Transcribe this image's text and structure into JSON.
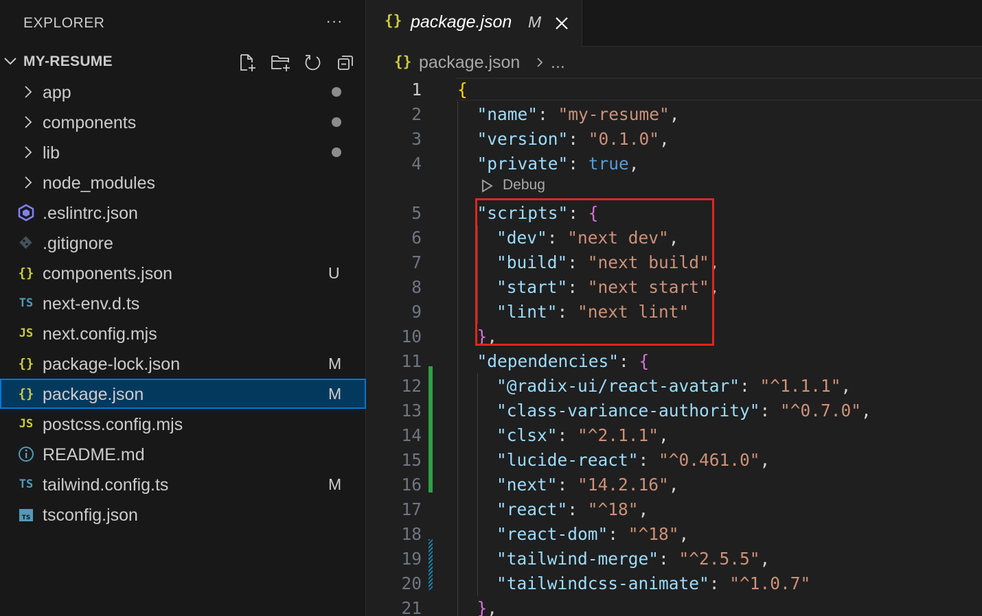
{
  "explorer": {
    "title": "EXPLORER",
    "more_label": "···",
    "project": "MY-RESUME",
    "actions": [
      "new-file-icon",
      "new-folder-icon",
      "refresh-icon",
      "collapse-all-icon"
    ]
  },
  "tree": [
    {
      "label": "app",
      "kind": "folder",
      "decoration": "dot"
    },
    {
      "label": "components",
      "kind": "folder",
      "decoration": "dot"
    },
    {
      "label": "lib",
      "kind": "folder",
      "decoration": "dot"
    },
    {
      "label": "node_modules",
      "kind": "folder",
      "decoration": ""
    },
    {
      "label": ".eslintrc.json",
      "kind": "eslint",
      "decoration": ""
    },
    {
      "label": ".gitignore",
      "kind": "git",
      "decoration": ""
    },
    {
      "label": "components.json",
      "kind": "json",
      "icon": "{}",
      "decoration": "U"
    },
    {
      "label": "next-env.d.ts",
      "kind": "ts",
      "icon": "TS",
      "decoration": ""
    },
    {
      "label": "next.config.mjs",
      "kind": "js",
      "icon": "JS",
      "decoration": ""
    },
    {
      "label": "package-lock.json",
      "kind": "json",
      "icon": "{}",
      "decoration": "M"
    },
    {
      "label": "package.json",
      "kind": "json",
      "icon": "{}",
      "decoration": "M",
      "selected": true
    },
    {
      "label": "postcss.config.mjs",
      "kind": "js",
      "icon": "JS",
      "decoration": ""
    },
    {
      "label": "README.md",
      "kind": "info",
      "decoration": ""
    },
    {
      "label": "tailwind.config.ts",
      "kind": "ts",
      "icon": "TS",
      "decoration": "M"
    },
    {
      "label": "tsconfig.json",
      "kind": "tsconfig",
      "decoration": ""
    }
  ],
  "tab": {
    "icon": "{}",
    "label": "package.json",
    "modified": "M"
  },
  "breadcrumb": {
    "icon": "{}",
    "file": "package.json",
    "more": "..."
  },
  "codelens": {
    "label": "Debug"
  },
  "colors": {
    "key": "#9cdcfe",
    "string": "#ce9178",
    "keyword": "#569cd6",
    "bracket_level1": "#ffd700",
    "bracket_level2": "#da70d6",
    "highlight_box": "#e0261b",
    "selection": "#04395e"
  },
  "code": [
    {
      "n": "1",
      "tokens": [
        [
          "b1",
          "{"
        ]
      ]
    },
    {
      "n": "2",
      "tokens": [
        [
          "k",
          "\"name\""
        ],
        [
          "p",
          ": "
        ],
        [
          "s",
          "\"my-resume\""
        ],
        [
          "p",
          ","
        ]
      ]
    },
    {
      "n": "3",
      "tokens": [
        [
          "k",
          "\"version\""
        ],
        [
          "p",
          ": "
        ],
        [
          "s",
          "\"0.1.0\""
        ],
        [
          "p",
          ","
        ]
      ]
    },
    {
      "n": "4",
      "tokens": [
        [
          "k",
          "\"private\""
        ],
        [
          "p",
          ": "
        ],
        [
          "kw",
          "true"
        ],
        [
          "p",
          ","
        ]
      ]
    },
    {
      "n": "5",
      "tokens": [
        [
          "k",
          "\"scripts\""
        ],
        [
          "p",
          ": "
        ],
        [
          "b2",
          "{"
        ]
      ]
    },
    {
      "n": "6",
      "tokens": [
        [
          "k",
          "\"dev\""
        ],
        [
          "p",
          ": "
        ],
        [
          "s",
          "\"next dev\""
        ],
        [
          "p",
          ","
        ]
      ]
    },
    {
      "n": "7",
      "tokens": [
        [
          "k",
          "\"build\""
        ],
        [
          "p",
          ": "
        ],
        [
          "s",
          "\"next build\""
        ],
        [
          "p",
          ","
        ]
      ]
    },
    {
      "n": "8",
      "tokens": [
        [
          "k",
          "\"start\""
        ],
        [
          "p",
          ": "
        ],
        [
          "s",
          "\"next start\""
        ],
        [
          "p",
          ","
        ]
      ]
    },
    {
      "n": "9",
      "tokens": [
        [
          "k",
          "\"lint\""
        ],
        [
          "p",
          ": "
        ],
        [
          "s",
          "\"next lint\""
        ]
      ]
    },
    {
      "n": "10",
      "tokens": [
        [
          "b2",
          "}"
        ],
        [
          "p",
          ","
        ]
      ]
    },
    {
      "n": "11",
      "tokens": [
        [
          "k",
          "\"dependencies\""
        ],
        [
          "p",
          ": "
        ],
        [
          "b2",
          "{"
        ]
      ]
    },
    {
      "n": "12",
      "tokens": [
        [
          "k",
          "\"@radix-ui/react-avatar\""
        ],
        [
          "p",
          ": "
        ],
        [
          "s",
          "\"^1.1.1\""
        ],
        [
          "p",
          ","
        ]
      ]
    },
    {
      "n": "13",
      "tokens": [
        [
          "k",
          "\"class-variance-authority\""
        ],
        [
          "p",
          ": "
        ],
        [
          "s",
          "\"^0.7.0\""
        ],
        [
          "p",
          ","
        ]
      ]
    },
    {
      "n": "14",
      "tokens": [
        [
          "k",
          "\"clsx\""
        ],
        [
          "p",
          ": "
        ],
        [
          "s",
          "\"^2.1.1\""
        ],
        [
          "p",
          ","
        ]
      ]
    },
    {
      "n": "15",
      "tokens": [
        [
          "k",
          "\"lucide-react\""
        ],
        [
          "p",
          ": "
        ],
        [
          "s",
          "\"^0.461.0\""
        ],
        [
          "p",
          ","
        ]
      ]
    },
    {
      "n": "16",
      "tokens": [
        [
          "k",
          "\"next\""
        ],
        [
          "p",
          ": "
        ],
        [
          "s",
          "\"14.2.16\""
        ],
        [
          "p",
          ","
        ]
      ]
    },
    {
      "n": "17",
      "tokens": [
        [
          "k",
          "\"react\""
        ],
        [
          "p",
          ": "
        ],
        [
          "s",
          "\"^18\""
        ],
        [
          "p",
          ","
        ]
      ]
    },
    {
      "n": "18",
      "tokens": [
        [
          "k",
          "\"react-dom\""
        ],
        [
          "p",
          ": "
        ],
        [
          "s",
          "\"^18\""
        ],
        [
          "p",
          ","
        ]
      ]
    },
    {
      "n": "19",
      "tokens": [
        [
          "k",
          "\"tailwind-merge\""
        ],
        [
          "p",
          ": "
        ],
        [
          "s",
          "\"^2.5.5\""
        ],
        [
          "p",
          ","
        ]
      ]
    },
    {
      "n": "20",
      "tokens": [
        [
          "k",
          "\"tailwindcss-animate\""
        ],
        [
          "p",
          ": "
        ],
        [
          "s",
          "\"^1.0.7\""
        ]
      ]
    },
    {
      "n": "21",
      "tokens": [
        [
          "b2",
          "}"
        ],
        [
          "p",
          ","
        ]
      ]
    }
  ]
}
